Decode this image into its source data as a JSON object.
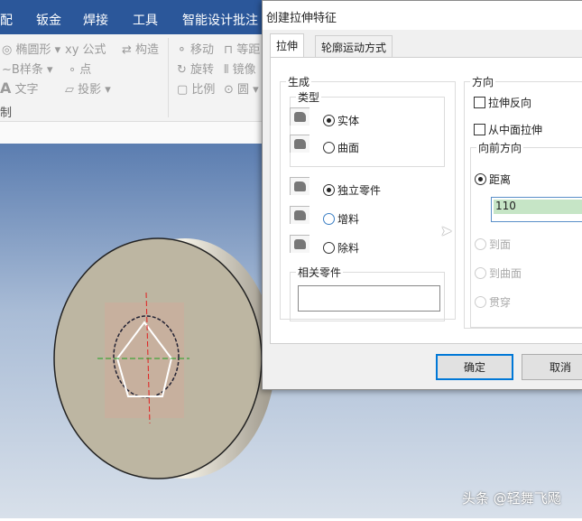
{
  "menubar": [
    "配",
    "钣金",
    "焊接",
    "工具",
    "智能设计批注"
  ],
  "ribbon": {
    "ellipse": "椭圆形",
    "formula": "公式",
    "construct": "构造",
    "bspline": "B样条",
    "point": "点",
    "text": "文字",
    "project": "投影",
    "draw": "制",
    "move": "移动",
    "offset": "等距",
    "rotate": "旋转",
    "mirror": "镜像",
    "scale": "比例",
    "circle": "圆"
  },
  "watermark": "头条 @轻舞飞飏",
  "dialog": {
    "title": "创建拉伸特征",
    "tabs": [
      "拉伸",
      "轮廓运动方式"
    ],
    "generate": {
      "label": "生成",
      "type_label": "类型",
      "solid": "实体",
      "surface": "曲面",
      "independent": "独立零件",
      "add": "增料",
      "remove": "除料",
      "related_label": "相关零件",
      "related_value": ""
    },
    "direction": {
      "label": "方向",
      "reverse": "拉伸反向",
      "from_mid": "从中面拉伸",
      "forward_label": "向前方向",
      "distance": "距离",
      "distance_value": "110",
      "to_face": "到面",
      "to_surface": "到曲面",
      "through": "贯穿"
    },
    "ok": "确定",
    "cancel": "取消"
  }
}
